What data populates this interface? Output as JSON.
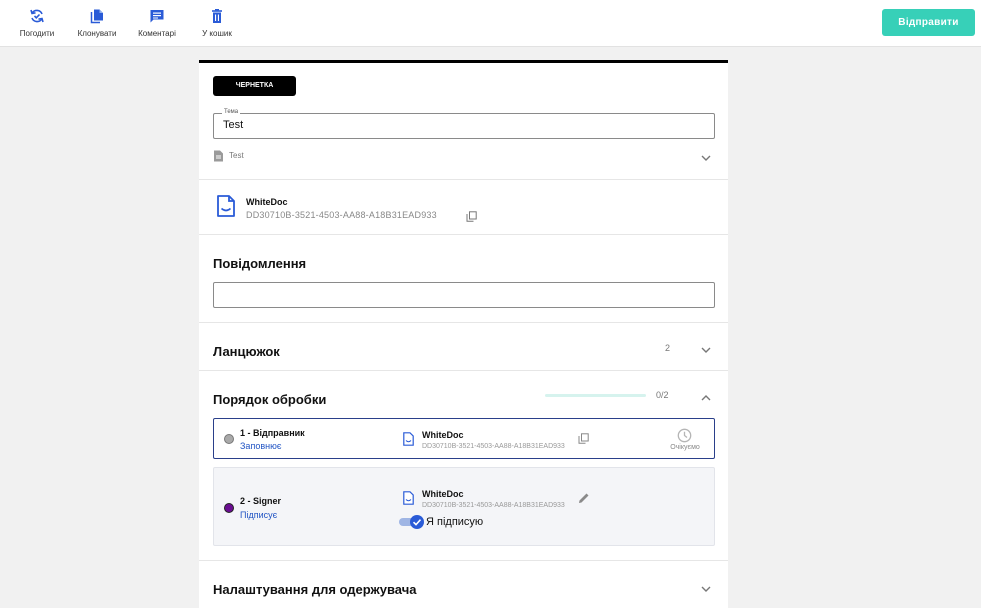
{
  "toolbar": {
    "approve_label": "Погодити",
    "clone_label": "Клонувати",
    "comments_label": "Коментарі",
    "trash_label": "У кошик",
    "send_label": "Відправити",
    "icons": [
      "approve-icon",
      "clone-icon",
      "comment-icon",
      "trash-icon"
    ]
  },
  "document": {
    "status": "ЧЕРНЕТКА",
    "subject_legend": "Тема",
    "subject_value": "Test",
    "doc_title": "Test"
  },
  "file": {
    "name": "WhiteDoc",
    "id": "DD30710B-3521-4503-AA88-A18B31EAD933"
  },
  "message": {
    "title": "Повідомлення",
    "value": ""
  },
  "chain": {
    "title": "Ланцюжок",
    "count": "2"
  },
  "processing": {
    "title": "Порядок обробки",
    "progress_text": "0/2",
    "progress_fraction": 0,
    "steps": [
      {
        "name": "1 - Відправник",
        "role": "Заповнює",
        "file_name": "WhiteDoc",
        "file_id": "DD30710B-3521-4503-AA88-A18B31EAD933",
        "status": "Очікуємо",
        "dot_color": "#a9a9a9"
      },
      {
        "name": "2 - Signer",
        "role": "Підписує",
        "file_name": "WhiteDoc",
        "file_id": "DD30710B-3521-4503-AA88-A18B31EAD933",
        "sign_label": "Я підписую",
        "sign_enabled": true,
        "dot_color": "#6a0d91"
      }
    ]
  },
  "recipient_settings": {
    "title": "Налаштування для одержувача"
  },
  "colors": {
    "accent": "#37d0b8",
    "link": "#2255c4",
    "primary": "#2a5bd7",
    "active_border": "#2a3f8a"
  }
}
